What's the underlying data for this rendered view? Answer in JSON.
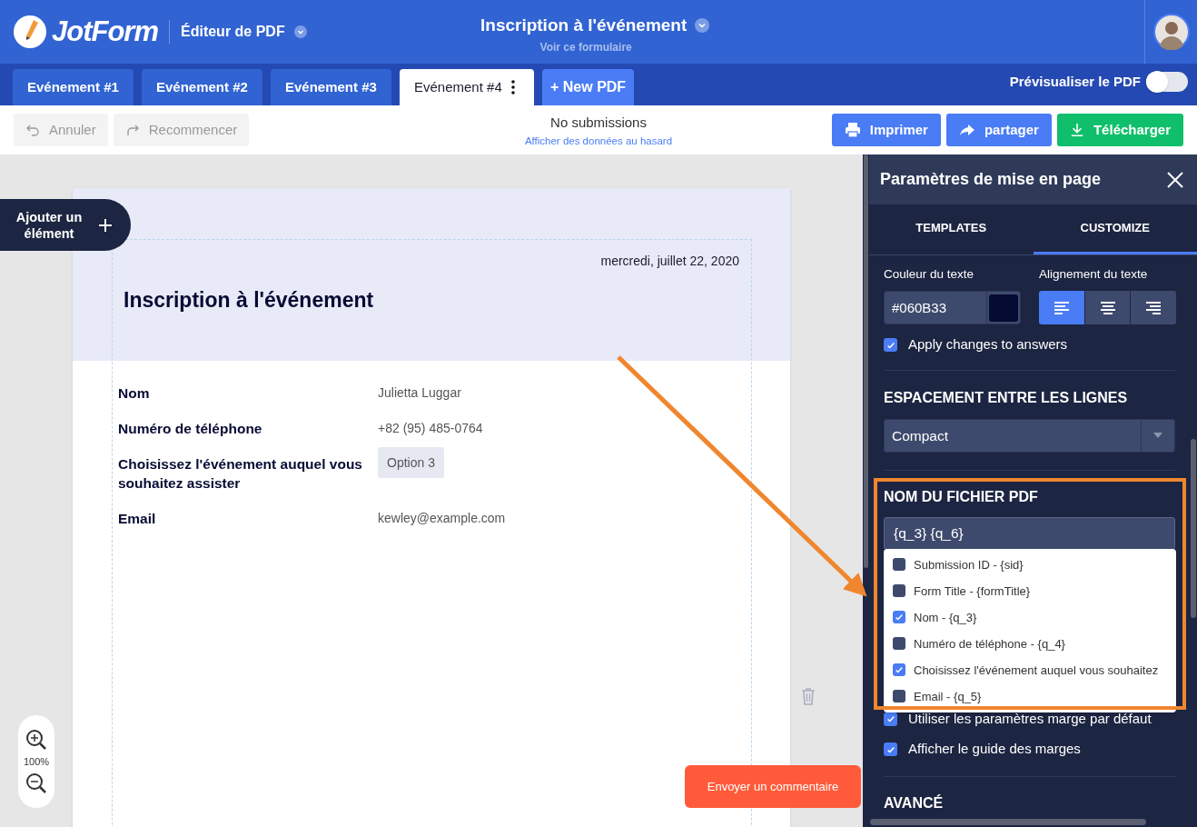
{
  "header": {
    "logo": "JotForm",
    "app": "Éditeur de PDF",
    "title": "Inscription à l'événement",
    "subtitle": "Voir ce formulaire"
  },
  "tabs": [
    {
      "label": "Evénement #1",
      "selected": false
    },
    {
      "label": "Evénement #2",
      "selected": false
    },
    {
      "label": "Evénement #3",
      "selected": false
    },
    {
      "label": "Evénement #4",
      "selected": true
    }
  ],
  "new_pdf": "+ New PDF",
  "preview": {
    "label": "Prévisualiser le PDF",
    "on": false
  },
  "history": [
    {
      "kind": "undo",
      "label": "Annuler",
      "disabled": true
    },
    {
      "kind": "redo",
      "label": "Recommencer",
      "disabled": true
    }
  ],
  "submissions": {
    "text": "No submissions",
    "link": "Afficher des données au hasard"
  },
  "actions": [
    {
      "kind": "print",
      "label": "Imprimer"
    },
    {
      "kind": "share",
      "label": "partager"
    },
    {
      "kind": "download",
      "label": "Télécharger"
    }
  ],
  "add_element": "Ajouter un élément",
  "document": {
    "date": "mercredi, juillet 22, 2020",
    "title": "Inscription à l'événement",
    "fields": [
      {
        "kind": "text",
        "label": "Nom",
        "value": "Julietta Luggar"
      },
      {
        "kind": "text",
        "label": "Numéro de téléphone",
        "value": "+82 (95) 485-0764"
      },
      {
        "kind": "option",
        "label": "Choisissez l'événement auquel vous souhaitez assister",
        "value": "Option 3"
      },
      {
        "kind": "text",
        "label": "Email",
        "value": "kewley@example.com"
      }
    ]
  },
  "zoom": "100%",
  "feedback": "Envoyer un commentaire",
  "panel": {
    "title": "Paramètres de mise en page",
    "tabs": [
      {
        "label": "TEMPLATES",
        "selected": false
      },
      {
        "label": "CUSTOMIZE",
        "selected": true
      }
    ],
    "text_color": {
      "label": "Couleur du texte",
      "value": "#060B33"
    },
    "alignment": {
      "label": "Alignement du texte",
      "options": [
        {
          "kind": "left",
          "selected": true
        },
        {
          "kind": "center",
          "selected": false
        },
        {
          "kind": "right",
          "selected": false
        }
      ]
    },
    "apply_changes": {
      "label": "Apply changes to answers",
      "checked": true
    },
    "line_spacing": {
      "heading": "ESPACEMENT ENTRE LES LIGNES",
      "value": "Compact"
    },
    "filename": {
      "heading": "NOM DU FICHIER PDF",
      "value": "{q_3} {q_6}",
      "options": [
        {
          "label": "Submission ID - {sid}",
          "checked": false
        },
        {
          "label": "Form Title - {formTitle}",
          "checked": false
        },
        {
          "label": "Nom - {q_3}",
          "checked": true
        },
        {
          "label": "Numéro de téléphone - {q_4}",
          "checked": false
        },
        {
          "label": "Choisissez l'événement auquel vous souhaitez",
          "checked": true
        },
        {
          "label": "Email - {q_5}",
          "checked": false
        }
      ]
    },
    "margins": [
      {
        "label": "Utiliser les paramètres marge par défaut",
        "checked": true
      },
      {
        "label": "Afficher le guide des marges",
        "checked": true
      }
    ],
    "advanced": "AVANCÉ"
  }
}
